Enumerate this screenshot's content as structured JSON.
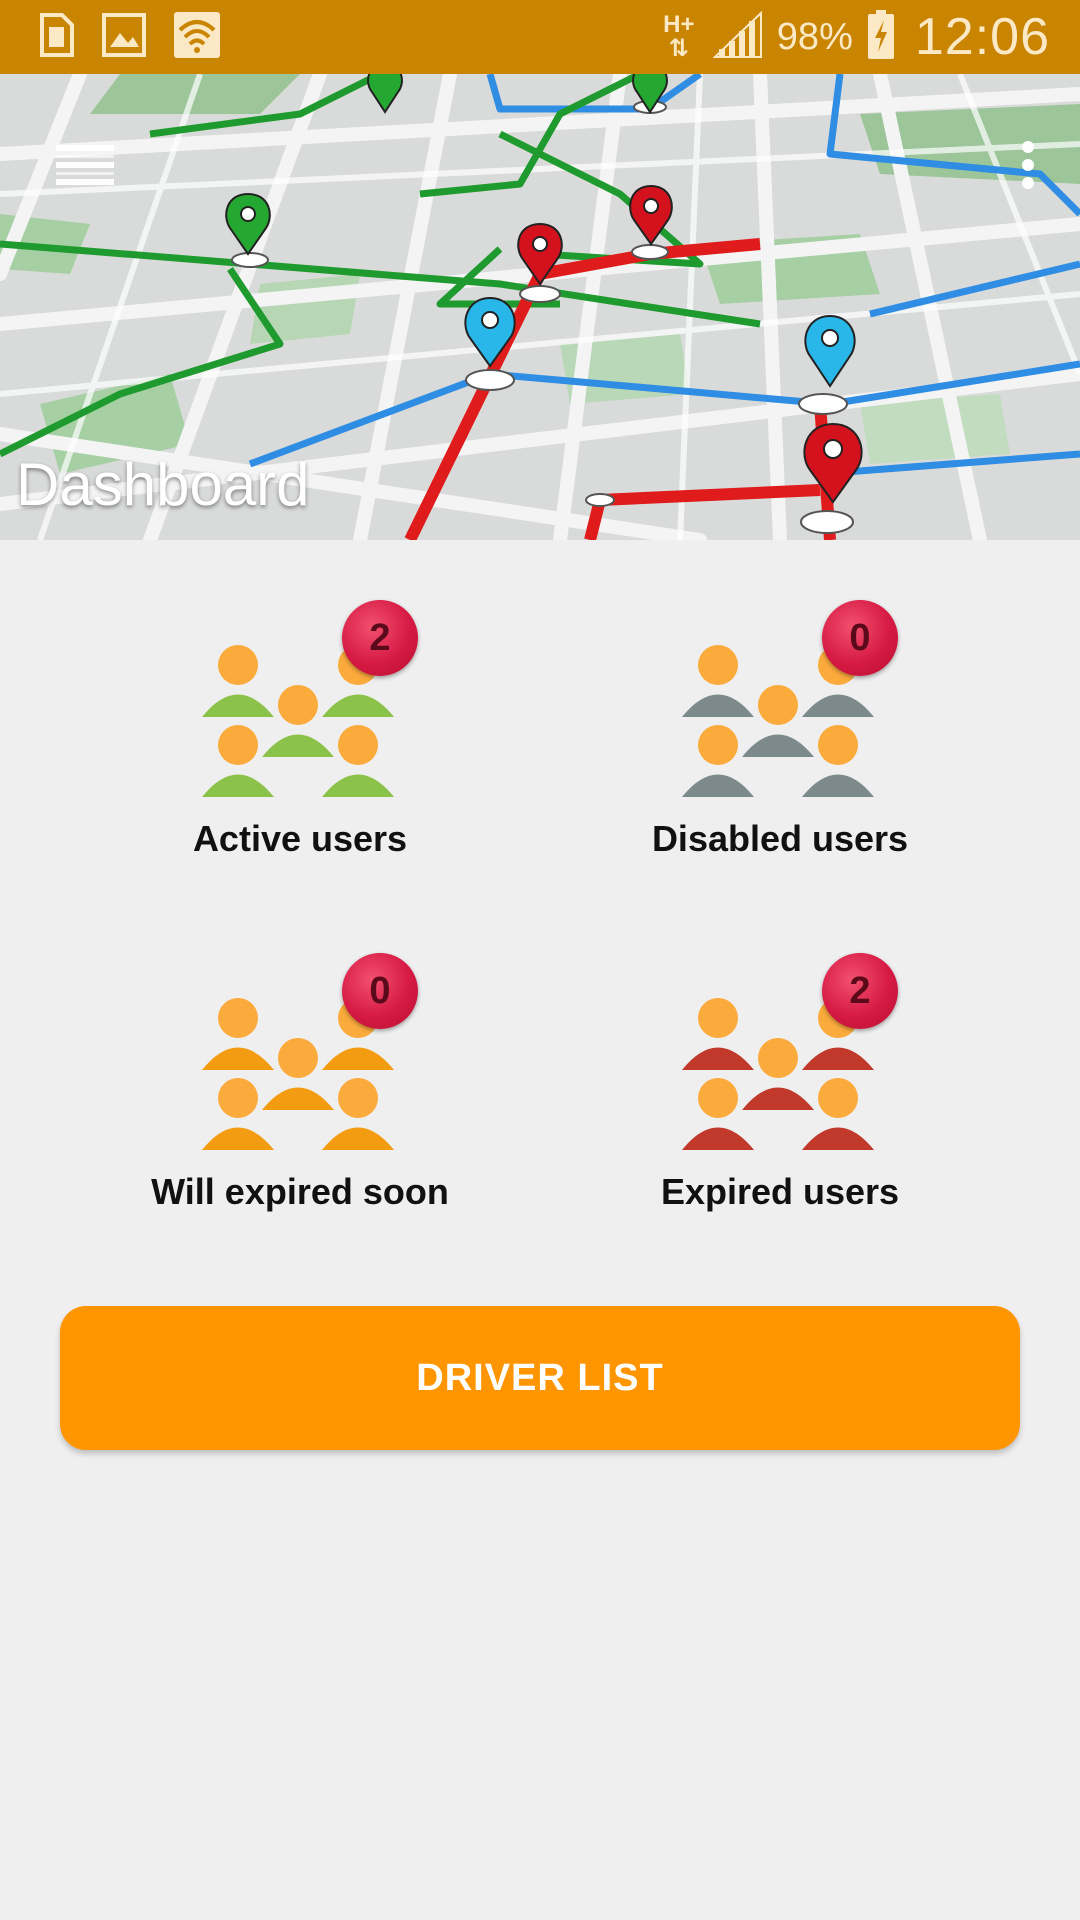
{
  "status_bar": {
    "battery_text": "98%",
    "clock": "12:06",
    "network_type": "H+",
    "icons": [
      "sim-card-icon",
      "image-icon",
      "wifi-icon",
      "network-data-icon",
      "signal-icon",
      "battery-charging-icon"
    ]
  },
  "header": {
    "title": "Dashboard",
    "menu_icon": "hamburger-menu-icon",
    "overflow_icon": "more-vertical-icon"
  },
  "tiles": [
    {
      "label": "Active users",
      "count": "2",
      "color": "#8bc34a"
    },
    {
      "label": "Disabled users",
      "count": "0",
      "color": "#7d8a8c"
    },
    {
      "label": "Will expired soon",
      "count": "0",
      "color": "#f39c12"
    },
    {
      "label": "Expired users",
      "count": "2",
      "color": "#c0392b"
    }
  ],
  "colors": {
    "status_bar": "#c98400",
    "accent": "#ff9500",
    "badge": "#d61a44",
    "head": "#fbab3c",
    "background": "#efeff0"
  },
  "driver_button": {
    "label": "DRIVER LIST"
  }
}
